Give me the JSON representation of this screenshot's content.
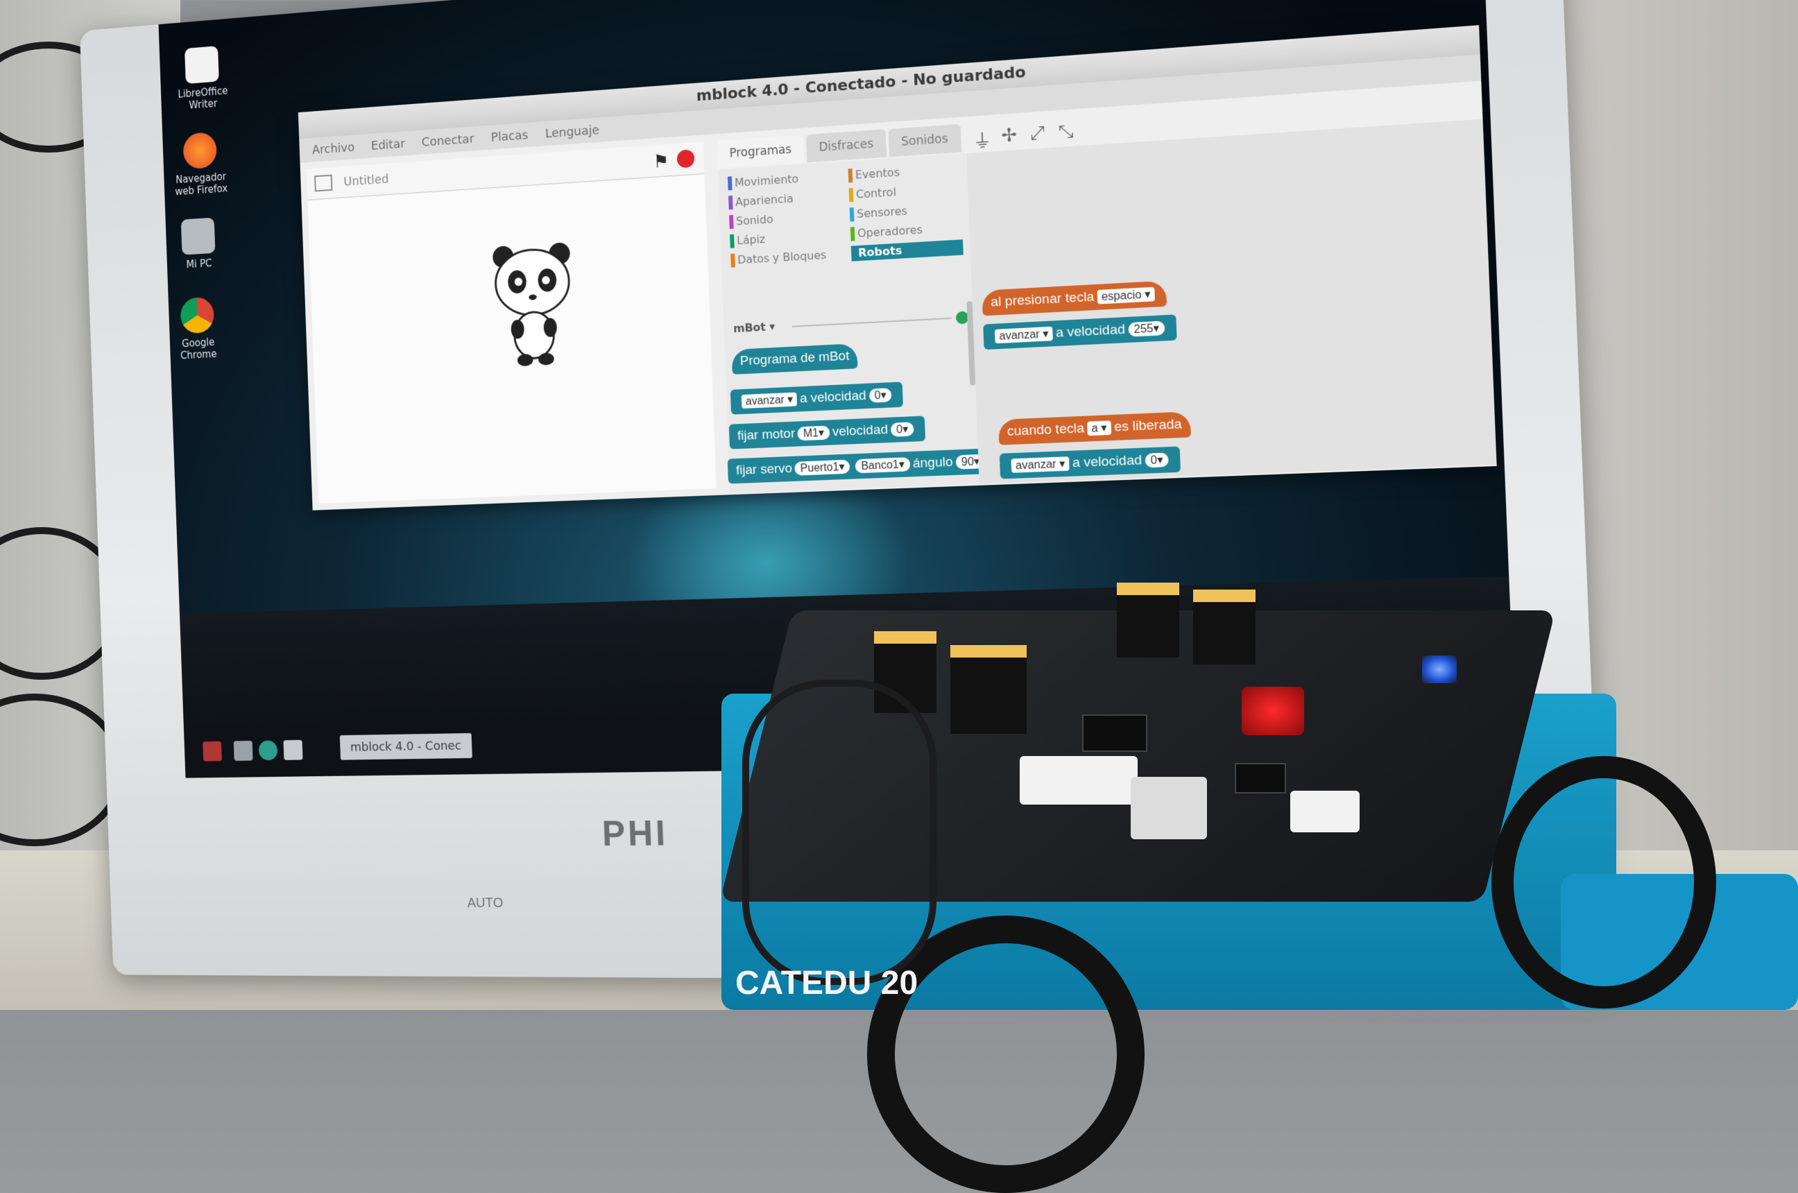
{
  "desktop_icons": [
    {
      "label": "LibreOffice\nWriter",
      "icon": "document-icon"
    },
    {
      "label": "Navegador\nweb Firefox",
      "icon": "firefox-icon"
    },
    {
      "label": "Mi PC",
      "icon": "computer-icon"
    },
    {
      "label": "Google\nChrome",
      "icon": "chrome-icon"
    }
  ],
  "taskbar": {
    "item_label": "mblock 4.0 - Conec"
  },
  "window": {
    "title": "mblock 4.0 - Conectado - No guardado",
    "menu": [
      "Archivo",
      "Editar",
      "Conectar",
      "Placas",
      "Lenguaje"
    ]
  },
  "stage": {
    "title": "Untitled"
  },
  "tabs": [
    "Programas",
    "Disfraces",
    "Sonidos"
  ],
  "categories_left": [
    "Movimiento",
    "Apariencia",
    "Sonido",
    "Lápiz",
    "Datos y Bloques"
  ],
  "categories_right": [
    "Eventos",
    "Control",
    "Sensores",
    "Operadores",
    "Robots"
  ],
  "category_colors": {
    "Movimiento": "#4a6cd4",
    "Apariencia": "#8a55d7",
    "Sonido": "#bb42c3",
    "Lápiz": "#0e9a6c",
    "Datos y Bloques": "#ee7d16",
    "Eventos": "#c88330",
    "Control": "#e1a91a",
    "Sensores": "#2ca5e2",
    "Operadores": "#5cb712",
    "Robots": "#1f8497"
  },
  "palette": {
    "header": "mBot",
    "blocks": {
      "program": "Programa de mBot",
      "move": {
        "action": "avanzar",
        "text": "a velocidad",
        "value": "0"
      },
      "motor": {
        "text1": "fijar motor",
        "motor": "M1",
        "text2": "velocidad",
        "value": "0"
      },
      "servo": {
        "text1": "fijar servo",
        "port": "Puerto1",
        "bank": "Banco1",
        "text2": "ángulo",
        "value": "90"
      }
    }
  },
  "script": {
    "hat1": {
      "text": "al presionar tecla",
      "key": "espacio"
    },
    "move1": {
      "action": "avanzar",
      "text": "a velocidad",
      "value": "255"
    },
    "hat2": {
      "text1": "cuando tecla",
      "key": "a",
      "text2": "es liberada"
    },
    "move2": {
      "action": "avanzar",
      "text": "a velocidad",
      "value": "0"
    }
  },
  "monitor": {
    "brand": "PHI",
    "button_label": "AUTO"
  },
  "robot": {
    "plate_text": "CATEDU 20"
  }
}
